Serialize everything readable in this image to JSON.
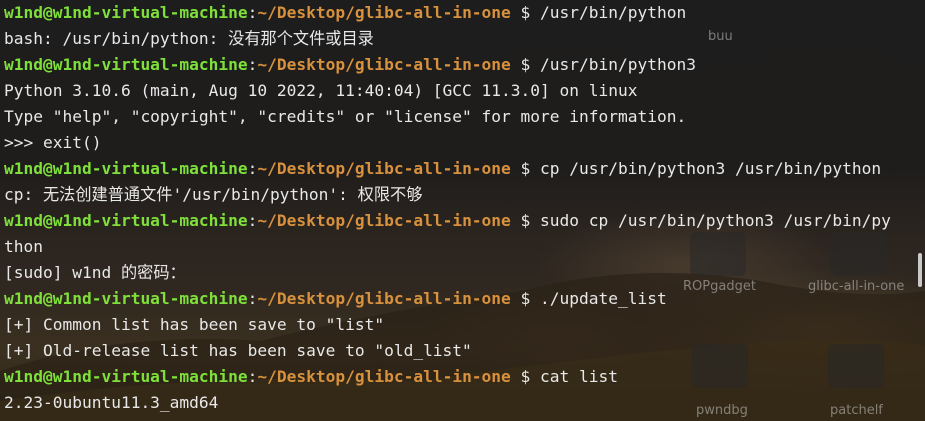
{
  "desktop": {
    "icons": [
      {
        "label": "buu"
      },
      {
        "label": "ROPgadget"
      },
      {
        "label": "glibc-all-in-one"
      },
      {
        "label": "pwndbg"
      },
      {
        "label": "patchelf"
      }
    ]
  },
  "terminal": {
    "user_host": "w1nd@w1nd-virtual-machine",
    "cwd": "~/Desktop/glibc-all-in-one",
    "lines": [
      {
        "kind": "prompt",
        "cmd": " $ /usr/bin/python"
      },
      {
        "kind": "output",
        "text": "bash: /usr/bin/python: 没有那个文件或目录"
      },
      {
        "kind": "prompt",
        "cmd": " $ /usr/bin/python3"
      },
      {
        "kind": "output",
        "text": "Python 3.10.6 (main, Aug 10 2022, 11:40:04) [GCC 11.3.0] on linux"
      },
      {
        "kind": "output",
        "text": "Type \"help\", \"copyright\", \"credits\" or \"license\" for more information."
      },
      {
        "kind": "output",
        "text": ">>> exit()"
      },
      {
        "kind": "prompt",
        "cmd": " $ cp /usr/bin/python3 /usr/bin/python"
      },
      {
        "kind": "output",
        "text": "cp: 无法创建普通文件'/usr/bin/python': 权限不够"
      },
      {
        "kind": "prompt",
        "cmd": " $ sudo cp /usr/bin/python3 /usr/bin/py"
      },
      {
        "kind": "output",
        "text": "thon"
      },
      {
        "kind": "output",
        "text": "[sudo] w1nd 的密码："
      },
      {
        "kind": "prompt",
        "cmd": " $ ./update_list"
      },
      {
        "kind": "output",
        "text": "[+] Common list has been save to \"list\""
      },
      {
        "kind": "output",
        "text": "[+] Old-release list has been save to \"old_list\""
      },
      {
        "kind": "prompt",
        "cmd": " $ cat list"
      },
      {
        "kind": "output",
        "text": "2.23-0ubuntu11.3_amd64"
      }
    ]
  }
}
